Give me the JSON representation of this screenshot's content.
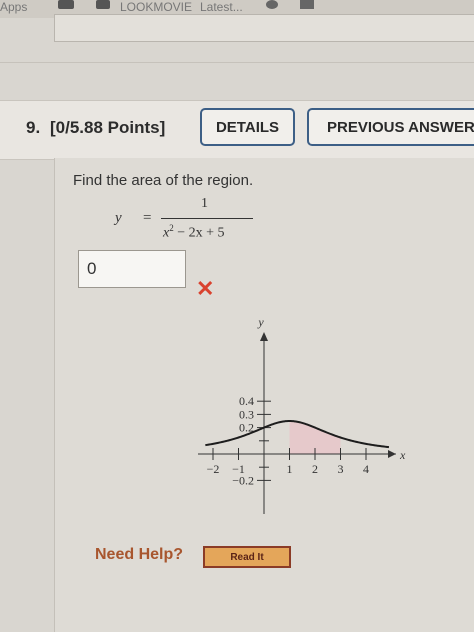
{
  "browser": {
    "bookmarks": [
      "Apps",
      "LOOKMOVIE",
      "Latest..."
    ]
  },
  "question": {
    "number": "9.",
    "points": "[0/5.88 Points]",
    "details_label": "DETAILS",
    "previous_answers_label": "PREVIOUS ANSWERS",
    "prompt": "Find the area of the region.",
    "equation": {
      "lhs": "y",
      "equals": "=",
      "numerator": "1",
      "denominator_pre": "x",
      "denominator_exp": "2",
      "denominator_post": " − 2x + 5"
    },
    "answer_value": "0",
    "answer_status": "✕"
  },
  "chart_data": {
    "type": "line",
    "function": "y = 1/(x^2 - 2x + 5)",
    "xlabel": "x",
    "ylabel": "y",
    "xlim": [
      -2.5,
      5.2
    ],
    "ylim": [
      -0.25,
      0.5
    ],
    "x_ticks": [
      -2,
      -1,
      1,
      2,
      3,
      4
    ],
    "x_tick_labels": [
      "−2",
      "−1",
      "1",
      "2",
      "3",
      "4"
    ],
    "y_ticks": [
      0.4,
      0.3,
      0.2,
      -0.2
    ],
    "y_tick_labels": [
      "0.4",
      "0.3",
      "0.2",
      "−0.2"
    ],
    "shaded_region": [
      1,
      3
    ],
    "curve_color": "#1d1d1d",
    "shade_color": "#e6c9cb",
    "grid": false
  },
  "help": {
    "label": "Need Help?",
    "read_it_label": "Read It"
  }
}
